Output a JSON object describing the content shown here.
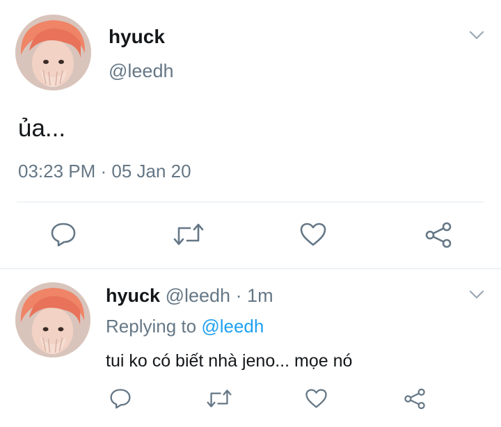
{
  "main_tweet": {
    "author_name": "hyuck",
    "author_handle": "@leedh",
    "text": "ủa...",
    "timestamp": "03:23 PM · 05 Jan 20",
    "actions": [
      "reply",
      "retweet",
      "like",
      "share"
    ]
  },
  "reply_tweet": {
    "author_name": "hyuck",
    "author_handle": "@leedh",
    "time_ago": "· 1m",
    "replying_to_label": "Replying to",
    "replying_to_handle": "@leedh",
    "text": "tui ko có biết nhà jeno... mọe nó",
    "actions": [
      "reply",
      "retweet",
      "like",
      "share"
    ]
  },
  "colors": {
    "text_primary": "#14171a",
    "text_secondary": "#657786",
    "accent": "#1da1f2",
    "divider": "#e1e8ed"
  }
}
